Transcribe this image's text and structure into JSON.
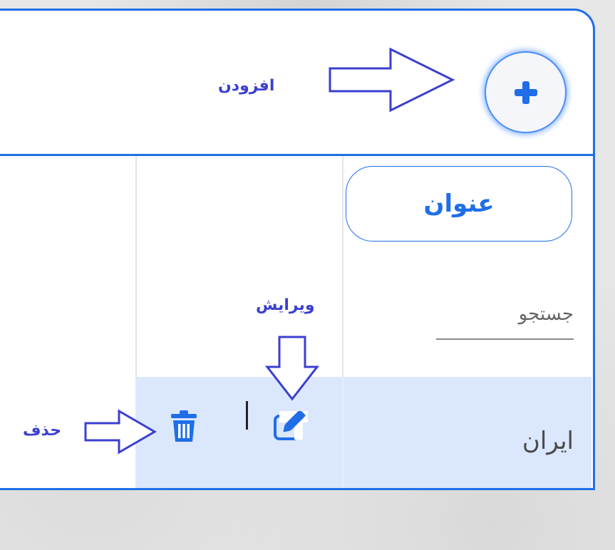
{
  "header": {
    "add_icon": "plus-icon"
  },
  "table": {
    "column_title": "عنوان",
    "search_placeholder": "جستجو",
    "rows": [
      {
        "country": "ایران",
        "edit_icon": "pen-square-icon",
        "delete_icon": "trash-icon"
      }
    ]
  },
  "annotations": {
    "add": "افزودن",
    "edit": "ویرایش",
    "delete": "حذف"
  },
  "colors": {
    "accent": "#1f6ee8",
    "row_highlight": "#dbe7fc",
    "annotation": "#3b3fd0"
  }
}
